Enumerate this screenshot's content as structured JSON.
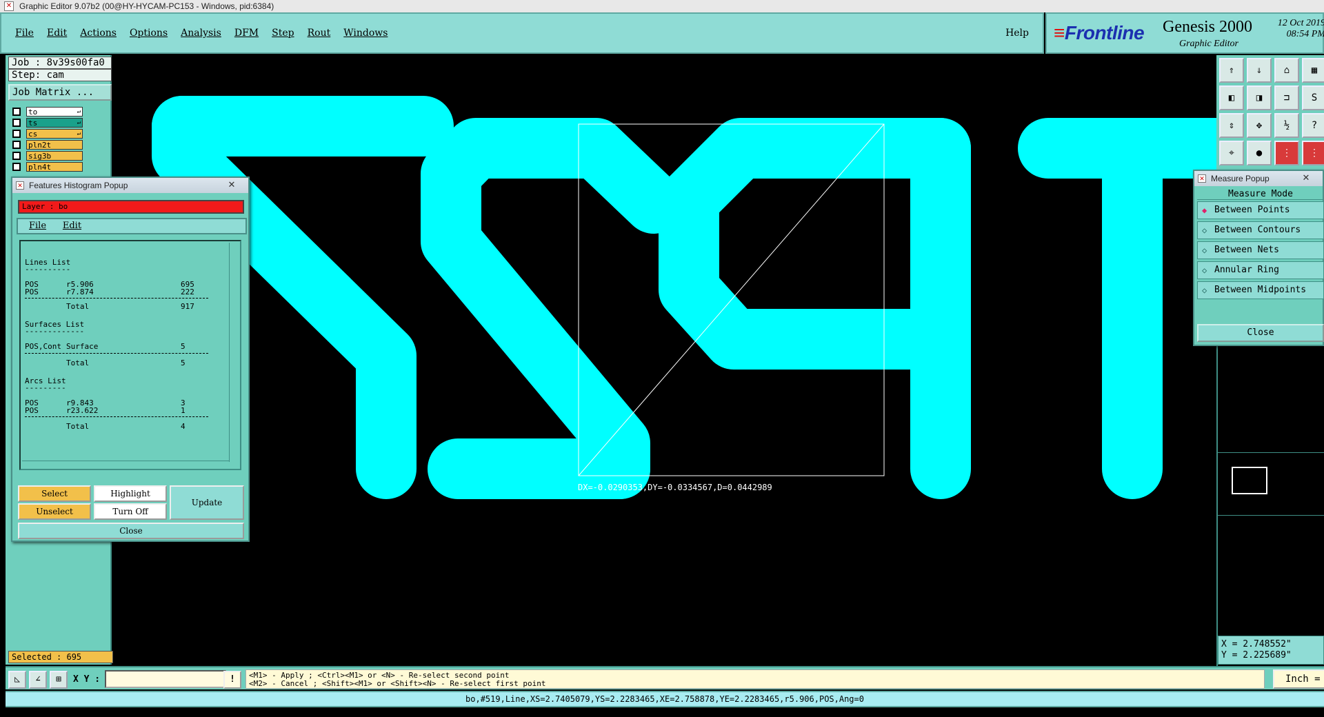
{
  "window": {
    "title": "Graphic Editor 9.07b2 (00@HY-HYCAM-PC153 - Windows, pid:6384)"
  },
  "menubar": {
    "items": [
      "File",
      "Edit",
      "Actions",
      "Options",
      "Analysis",
      "DFM",
      "Step",
      "Rout",
      "Windows"
    ],
    "help": "Help"
  },
  "brand": {
    "logo": "Frontline",
    "product": "Genesis 2000",
    "subtitle": "Graphic Editor",
    "date": "12 Oct 2019",
    "time": "08:54 PM"
  },
  "left": {
    "job": "Job : 8v39s00fa0",
    "step": "Step: cam",
    "job_matrix": "Job Matrix ...",
    "layers": [
      {
        "name": "to",
        "color": "#ffffff",
        "mark": "↵"
      },
      {
        "name": "ts",
        "color": "#1aa18b",
        "mark": "↵"
      },
      {
        "name": "cs",
        "color": "#f2c04a",
        "mark": "↵"
      },
      {
        "name": "pln2t",
        "color": "#f2c04a",
        "mark": ""
      },
      {
        "name": "sig3b",
        "color": "#f2c04a",
        "mark": ""
      },
      {
        "name": "pln4t",
        "color": "#f2c04a",
        "mark": ""
      }
    ],
    "selected": "Selected : 695"
  },
  "histogram": {
    "title": "Features Histogram Popup",
    "close_glyph": "✕",
    "layer": "Layer :  bo",
    "menu": [
      "File",
      "Edit"
    ],
    "lines_list": {
      "header": "Lines List",
      "underline": "----------",
      "rows": [
        {
          "pol": "POS",
          "sym": "r5.906",
          "count": "695"
        },
        {
          "pol": "POS",
          "sym": "r7.874",
          "count": "222"
        }
      ],
      "total_label": "Total",
      "total": "917"
    },
    "surfaces_list": {
      "header": "Surfaces List",
      "underline": "-------------",
      "rows": [
        {
          "pol": "POS,Cont",
          "sym": "Surface",
          "count": "5"
        }
      ],
      "total_label": "Total",
      "total": "5"
    },
    "arcs_list": {
      "header": "Arcs List",
      "underline": "---------",
      "rows": [
        {
          "pol": "POS",
          "sym": "r9.843",
          "count": "3"
        },
        {
          "pol": "POS",
          "sym": "r23.622",
          "count": "1"
        }
      ],
      "total_label": "Total",
      "total": "4"
    },
    "buttons": {
      "select": "Select",
      "highlight": "Highlight",
      "unselect": "Unselect",
      "turn_off": "Turn Off",
      "update": "Update",
      "close": "Close"
    }
  },
  "measure": {
    "title": "Measure Popup",
    "close_glyph": "✕",
    "mode_header": "Measure Mode",
    "options": [
      {
        "label": "Between Points",
        "active": true
      },
      {
        "label": "Between Contours",
        "active": false
      },
      {
        "label": "Between Nets",
        "active": false
      },
      {
        "label": "Annular Ring",
        "active": false
      },
      {
        "label": "Between Midpoints",
        "active": false
      }
    ],
    "close": "Close"
  },
  "canvas": {
    "measurement": "DX=-0.0290353,DY=-0.0334567,D=0.0442989",
    "feature_color": "#00ffff"
  },
  "coords": {
    "x": "X = 2.748552\"",
    "y": "Y = 2.225689\""
  },
  "command": {
    "xy_label": "X Y :",
    "xy_value": "",
    "excl": "!",
    "hint1": "<M1> - Apply  ; <Ctrl><M1> or <N> - Re-select second point",
    "hint2": "<M2> - Cancel ; <Shift><M1> or <Shift><N> - Re-select first point",
    "units": "Inch ="
  },
  "status": {
    "text": "bo,#519,Line,XS=2.7405079,YS=2.2283465,XE=2.758878,YE=2.2283465,r5.906,POS,Ang=0"
  }
}
